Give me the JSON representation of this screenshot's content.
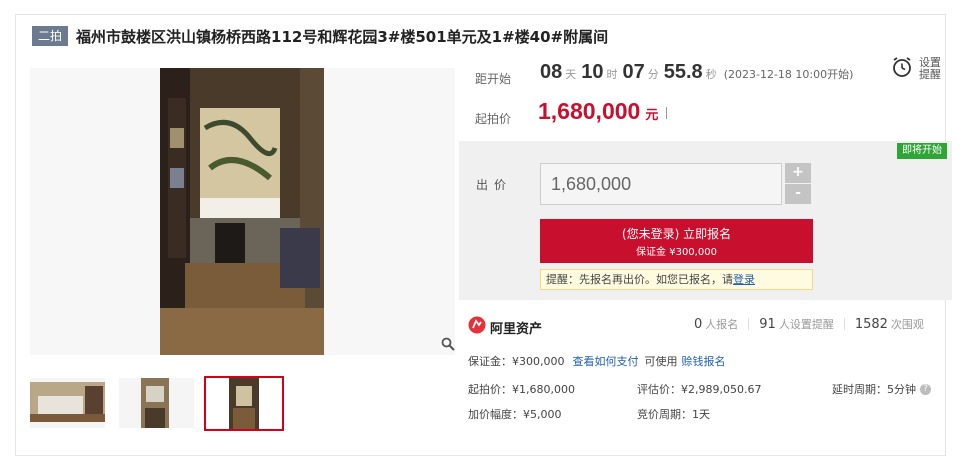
{
  "header": {
    "round_badge": "二拍",
    "title": "福州市鼓楼区洪山镇杨桥西路112号和辉花园3#楼501单元及1#楼40#附属间"
  },
  "countdown": {
    "label": "距开始",
    "days": "08",
    "days_unit": "天",
    "hours": "10",
    "hours_unit": "时",
    "minutes": "07",
    "minutes_unit": "分",
    "seconds": "55.8",
    "seconds_unit": "秒",
    "start_note": "(2023-12-18 10:00开始)"
  },
  "start_price": {
    "label": "起拍价",
    "value": "1,680,000",
    "unit": "元",
    "divider": "|"
  },
  "reminder": {
    "label": "设置提醒",
    "icon": "alarm-clock-icon"
  },
  "bid": {
    "status_badge": "即将开始",
    "label": "出价",
    "input_value": "1,680,000",
    "plus": "+",
    "minus": "-",
    "signup_label": "(您未登录) 立即报名",
    "deposit_note": "保证金 ¥300,000",
    "tip_prefix": "提醒：先报名再出价。如您已报名，请",
    "tip_link": "登录"
  },
  "platform": {
    "name": "阿里资产",
    "registered_count": "0",
    "registered_label": "人报名",
    "reminder_count": "91",
    "reminder_label": "人设置提醒",
    "view_count": "1582",
    "view_label": "次围观"
  },
  "details": {
    "deposit": "保证金：¥300,000",
    "how_to_pay": "查看如何支付",
    "can_use": "可使用",
    "credit_signup": "赊钱报名",
    "start_price": "起拍价：¥1,680,000",
    "appraisal": "评估价：¥2,989,050.67",
    "delay_period": "延时周期：5分钟",
    "increment": "加价幅度：¥5,000",
    "bid_period": "竞价周期：1天"
  },
  "colors": {
    "accent_red": "#c8102e",
    "link_blue": "#1f5fb5",
    "badge_green": "#2fa536",
    "round_badge": "#6b7a8f"
  }
}
